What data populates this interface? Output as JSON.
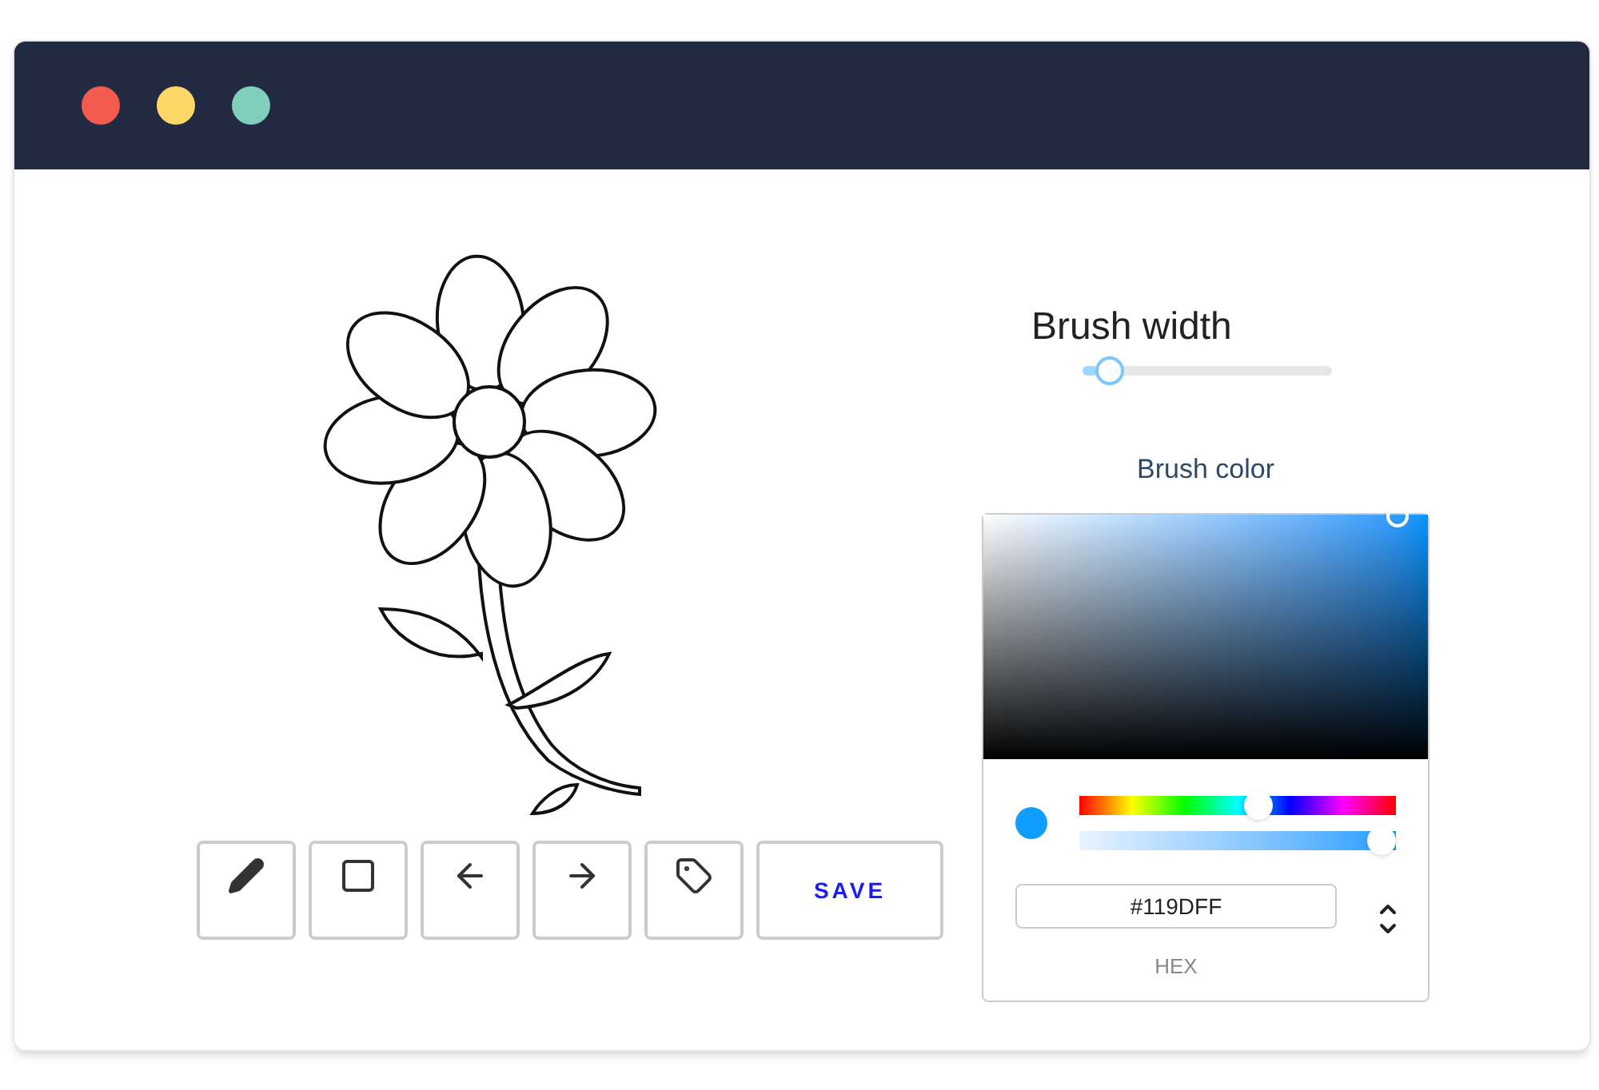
{
  "window": {
    "controls": [
      {
        "color": "#f45b4f"
      },
      {
        "color": "#fdd866"
      },
      {
        "color": "#7fcfbc"
      }
    ]
  },
  "toolbar": {
    "tools": [
      {
        "kind": "pencil"
      },
      {
        "kind": "square"
      },
      {
        "kind": "undo"
      },
      {
        "kind": "redo"
      },
      {
        "kind": "tag"
      }
    ],
    "save": "SAVE"
  },
  "brush_width": {
    "label": "Brush width",
    "level": 0.06
  },
  "brush_color": {
    "label": "Brush color",
    "hue": {
      "level": 0.57
    },
    "alpha": {
      "level": 1
    },
    "value": "#119DFF",
    "format": "HEX"
  }
}
